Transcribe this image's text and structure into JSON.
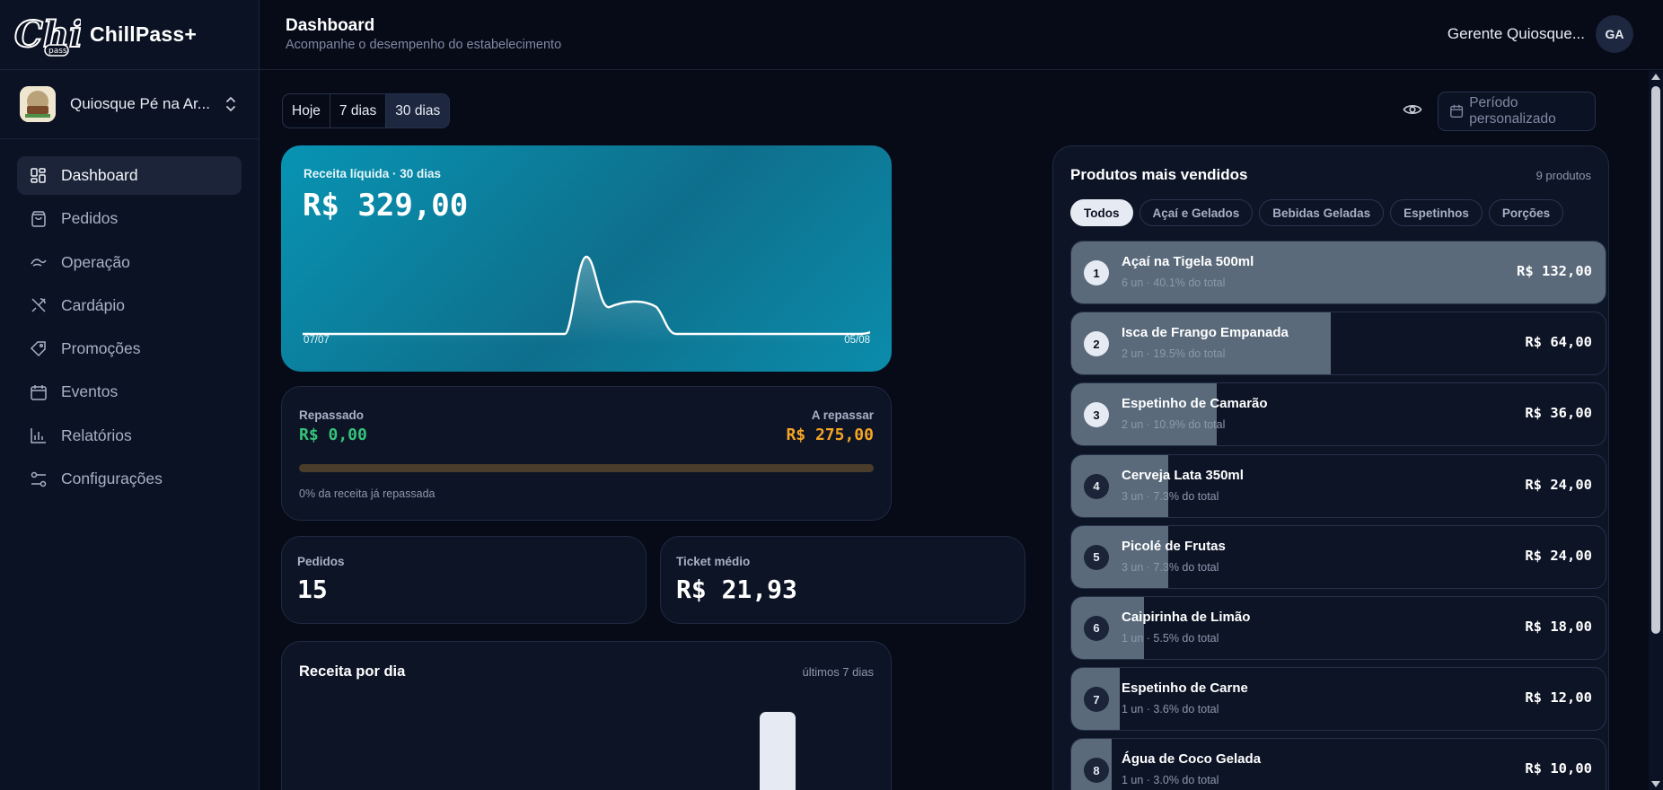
{
  "brand": {
    "logo_text": "Chill",
    "logo_sub": "pass",
    "name": "ChillPass+"
  },
  "store": {
    "name": "Quiosque Pé na Ar..."
  },
  "sidebar": {
    "items": [
      {
        "label": "Dashboard",
        "icon": "dashboard-icon",
        "active": true
      },
      {
        "label": "Pedidos",
        "icon": "bag-icon"
      },
      {
        "label": "Operação",
        "icon": "operation-icon"
      },
      {
        "label": "Cardápio",
        "icon": "utensils-icon"
      },
      {
        "label": "Promoções",
        "icon": "tag-icon"
      },
      {
        "label": "Eventos",
        "icon": "calendar-icon"
      },
      {
        "label": "Relatórios",
        "icon": "bar-chart-icon"
      },
      {
        "label": "Configurações",
        "icon": "settings-icon"
      }
    ]
  },
  "header": {
    "title": "Dashboard",
    "subtitle": "Acompanhe o desempenho do estabelecimento",
    "user_name": "Gerente Quiosque...",
    "user_initials": "GA"
  },
  "period": {
    "options": [
      "Hoje",
      "7 dias",
      "30 dias"
    ],
    "selected": "30 dias",
    "custom_label": "Período personalizado"
  },
  "revenue": {
    "label": "Receita líquida · 30 dias",
    "value": "R$ 329,00",
    "axis_start": "07/07",
    "axis_end": "05/08",
    "colors": {
      "card_from": "#0894b3",
      "card_to": "#0e6f8c",
      "line": "#ffffff"
    }
  },
  "transfer": {
    "passed_label": "Repassado",
    "passed_value": "R$ 0,00",
    "pending_label": "A repassar",
    "pending_value": "R$ 275,00",
    "progress_fraction": 0.0,
    "note": "0% da receita já repassada",
    "colors": {
      "passed": "#35c37a",
      "pending": "#f5a524"
    }
  },
  "stats": {
    "orders_label": "Pedidos",
    "orders_value": "15",
    "ticket_label": "Ticket médio",
    "ticket_value": "R$ 21,93"
  },
  "daily": {
    "title": "Receita por dia",
    "subtitle": "últimos 7 dias"
  },
  "products": {
    "title": "Produtos mais vendidos",
    "count": "9 produtos",
    "chips": [
      "Todos",
      "Açaí e Gelados",
      "Bebidas Geladas",
      "Espetinhos",
      "Porções"
    ],
    "items": [
      {
        "rank": "1",
        "name": "Açaí na Tigela 500ml",
        "meta": "6 un · 40.1% do total",
        "price": "R$ 132,00",
        "share": 1.0
      },
      {
        "rank": "2",
        "name": "Isca de Frango Empanada",
        "meta": "2 un · 19.5% do total",
        "price": "R$ 64,00",
        "share": 0.485
      },
      {
        "rank": "3",
        "name": "Espetinho de Camarão",
        "meta": "2 un · 10.9% do total",
        "price": "R$ 36,00",
        "share": 0.273
      },
      {
        "rank": "4",
        "name": "Cerveja Lata 350ml",
        "meta": "3 un · 7.3% do total",
        "price": "R$ 24,00",
        "share": 0.182
      },
      {
        "rank": "5",
        "name": "Picolé de Frutas",
        "meta": "3 un · 7.3% do total",
        "price": "R$ 24,00",
        "share": 0.182
      },
      {
        "rank": "6",
        "name": "Caipirinha de Limão",
        "meta": "1 un · 5.5% do total",
        "price": "R$ 18,00",
        "share": 0.136
      },
      {
        "rank": "7",
        "name": "Espetinho de Carne",
        "meta": "1 un · 3.6% do total",
        "price": "R$ 12,00",
        "share": 0.091
      },
      {
        "rank": "8",
        "name": "Água de Coco Gelada",
        "meta": "1 un · 3.0% do total",
        "price": "R$ 10,00",
        "share": 0.076
      }
    ]
  }
}
